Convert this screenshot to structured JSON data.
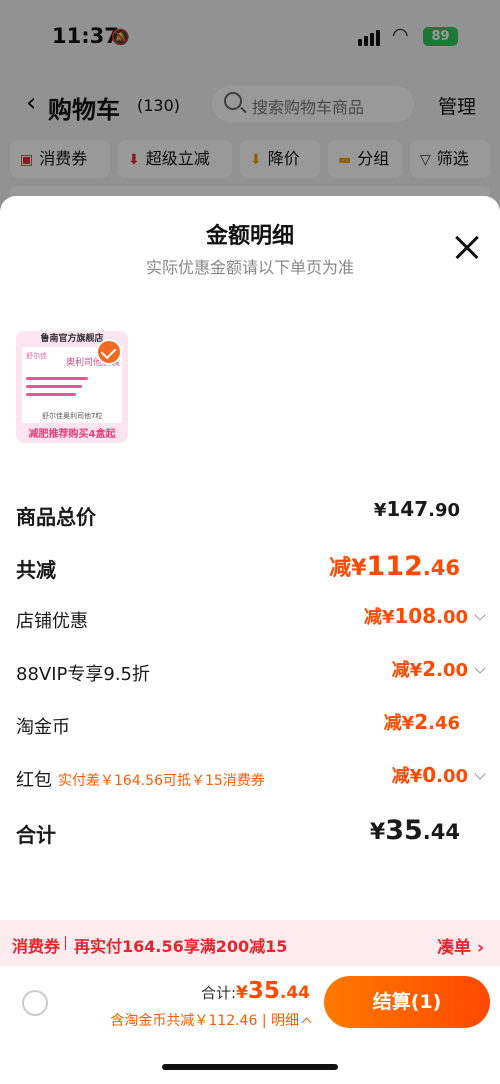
{
  "status_bar": {
    "time": "11:37",
    "battery": "89"
  },
  "nav": {
    "title": "购物车",
    "count": "(130)",
    "search_placeholder": "搜索购物车商品",
    "manage": "管理"
  },
  "chips": [
    {
      "label": "消费券",
      "icon": "coupon-icon"
    },
    {
      "label": "超级立减",
      "icon": "arrow-down-icon"
    },
    {
      "label": "降价",
      "icon": "price-drop-icon"
    },
    {
      "label": "分组",
      "icon": "folder-icon"
    },
    {
      "label": "筛选",
      "icon": "filter-icon"
    }
  ],
  "sheet": {
    "title": "金额明细",
    "subtitle": "实际优惠金额请以下单页为准",
    "product": {
      "store": "鲁南官方旗舰店",
      "brand": "舒尔佳",
      "name": "奥利司他胶囊",
      "spec": "舒尔佳奥利司他7粒",
      "promo": "减肥推荐购买4盒起"
    },
    "rows": {
      "subtotal": {
        "label": "商品总价",
        "currency": "¥",
        "int": "147",
        "dec": ".90"
      },
      "total_discount": {
        "label": "共减",
        "prefix": "减",
        "currency": "¥",
        "int": "112",
        "dec": ".46"
      },
      "store_discount": {
        "label": "店铺优惠",
        "prefix": "减",
        "currency": "¥",
        "int": "108",
        "dec": ".00"
      },
      "vip_discount": {
        "label": "88VIP专享9.5折",
        "prefix": "减",
        "currency": "¥",
        "int": "2",
        "dec": ".00"
      },
      "taojinbi": {
        "label": "淘金币",
        "prefix": "减",
        "currency": "¥",
        "int": "2",
        "dec": ".46"
      },
      "red_packet": {
        "label": "红包",
        "note": "实付差￥164.56可抵￥15消费券",
        "prefix": "减",
        "currency": "¥",
        "int": "0",
        "dec": ".00"
      },
      "total": {
        "label": "合计",
        "currency": "¥",
        "int": "35",
        "dec": ".44"
      }
    }
  },
  "banner": {
    "tag": "消费券",
    "message": "再实付164.56享满200减15",
    "action": "凑单 ›"
  },
  "footer": {
    "total_label": "合计:",
    "currency": "¥",
    "total_int": "35",
    "total_dec": ".44",
    "discount_text": "含淘金币共减￥112.46 | 明细",
    "checkout": "结算(1)"
  },
  "colors": {
    "accent": "#ff4a00",
    "banner_text": "#e8252e",
    "battery": "#34c759"
  }
}
